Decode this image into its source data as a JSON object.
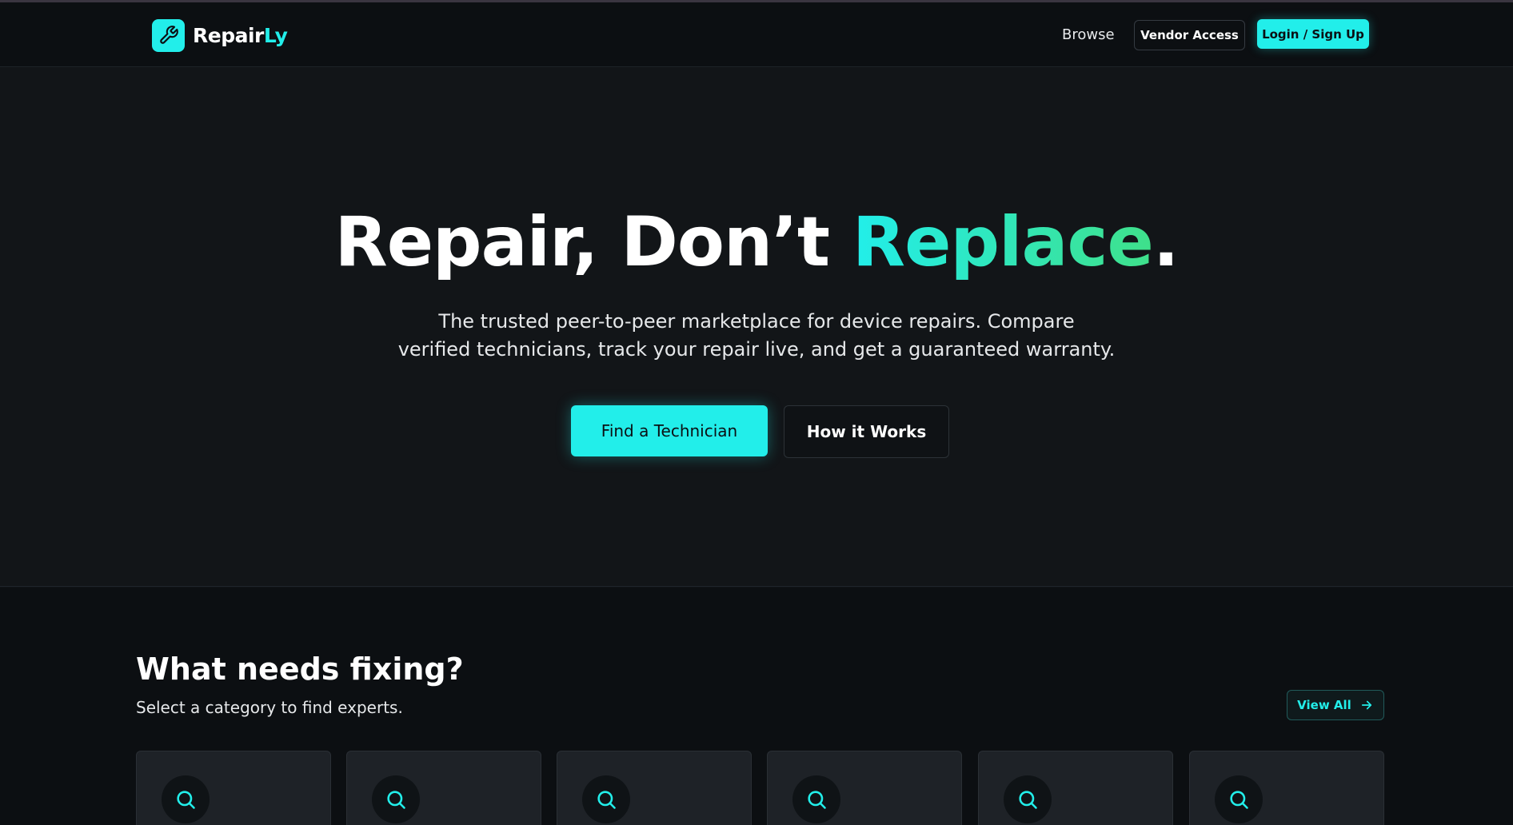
{
  "brand": {
    "name_part1": "Repair",
    "name_part2": "Ly",
    "accent_color": "#22eeea",
    "icon": "wrench-icon"
  },
  "nav": {
    "browse": "Browse",
    "vendor_access": "Vendor Access",
    "login": "Login / Sign Up"
  },
  "hero": {
    "title_part1": "Repair, Don’t ",
    "title_accent": "Replace",
    "title_end": ".",
    "subtitle_line1": "The trusted peer-to-peer marketplace for device repairs. Compare",
    "subtitle_line2": "verified technicians, track your repair live, and get a guaranteed warranty.",
    "primary_button": "Find a Technician",
    "secondary_button": "How it Works"
  },
  "categories": {
    "title": "What needs fixing?",
    "subtitle": "Select a category to find experts.",
    "view_all": "View All",
    "view_all_icon": "arrow-right-icon",
    "card_icon": "search-icon",
    "card_count": 6
  }
}
